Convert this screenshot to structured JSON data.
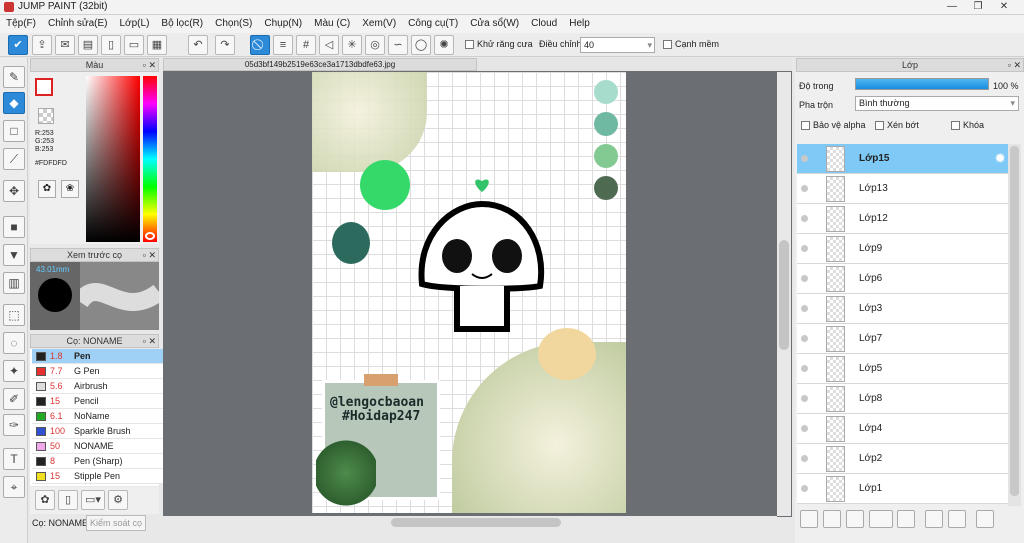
{
  "window": {
    "title": "JUMP PAINT (32bit)"
  },
  "menu": [
    "Tệp(F)",
    "Chỉnh sửa(E)",
    "Lớp(L)",
    "Bộ lọc(R)",
    "Chọn(S)",
    "Chụp(N)",
    "Màu (C)",
    "Xem(V)",
    "Công cụ(T)",
    "Cửa sổ(W)",
    "Cloud",
    "Help"
  ],
  "toolbar": {
    "antialias_label": "Khử răng cưa",
    "adjust_label": "Điều chỉnh",
    "adjust_value": "40",
    "sharp_edge_label": "Cạnh mềm"
  },
  "color_panel": {
    "title": "Màu",
    "r": "R:253",
    "g": "G:253",
    "b": "B:253",
    "hex": "#FDFDFD"
  },
  "brush_preview": {
    "title": "Xem trước cọ",
    "size": "43.01mm"
  },
  "brush_panel": {
    "title": "Cọ: NONAME",
    "footer_name": "Cọ: NONAME",
    "footer_button": "Kiểm soát cọ",
    "brushes": [
      {
        "size": "1.8",
        "name": "Pen",
        "color": "#222222"
      },
      {
        "size": "7.7",
        "name": "G Pen",
        "color": "#e53030"
      },
      {
        "size": "5.6",
        "name": "Airbrush",
        "color": "#dddddd"
      },
      {
        "size": "15",
        "name": "Pencil",
        "color": "#222222"
      },
      {
        "size": "6.1",
        "name": "NoName",
        "color": "#22aa22"
      },
      {
        "size": "100",
        "name": "Sparkle Brush",
        "color": "#3050d0"
      },
      {
        "size": "50",
        "name": "NONAME",
        "color": "#f0a8e8"
      },
      {
        "size": "8",
        "name": "Pen (Sharp)",
        "color": "#222222"
      },
      {
        "size": "15",
        "name": "Stipple Pen",
        "color": "#f0e020"
      }
    ]
  },
  "document": {
    "tab": "05d3bf149b2519e63ce3a1713dbdfe63.jpg",
    "watermark_line1": "@lengocbaoan",
    "watermark_line2": "#Hoidap247"
  },
  "layer_panel": {
    "title": "Lớp",
    "opacity_label": "Độ trong",
    "opacity_value": "100 %",
    "opacity_fraction": 1.0,
    "blend_label": "Pha trộn",
    "blend_value": "Bình thường",
    "protect_alpha": "Bảo vệ alpha",
    "clip": "Xén bớt",
    "lock": "Khóa",
    "layers": [
      "Lớp15",
      "Lớp13",
      "Lớp12",
      "Lớp9",
      "Lớp6",
      "Lớp3",
      "Lớp7",
      "Lớp5",
      "Lớp8",
      "Lớp4",
      "Lớp2",
      "Lớp1"
    ]
  },
  "colors": {
    "accent": "#2d8ad8",
    "selection": "#7ec9f5",
    "canvas_bg": "#6b6f74"
  }
}
